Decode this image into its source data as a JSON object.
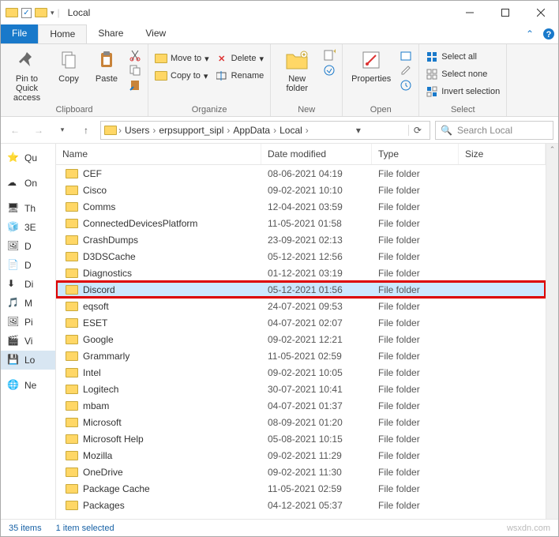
{
  "window": {
    "title": "Local"
  },
  "tabs": {
    "file": "File",
    "home": "Home",
    "share": "Share",
    "view": "View"
  },
  "ribbon": {
    "clipboard": {
      "pin": "Pin to Quick\naccess",
      "copy": "Copy",
      "paste": "Paste",
      "label": "Clipboard"
    },
    "organize": {
      "moveto": "Move to",
      "copyto": "Copy to",
      "delete": "Delete",
      "rename": "Rename",
      "label": "Organize"
    },
    "new": {
      "newfolder": "New\nfolder",
      "label": "New"
    },
    "open": {
      "properties": "Properties",
      "label": "Open"
    },
    "select": {
      "all": "Select all",
      "none": "Select none",
      "invert": "Invert selection",
      "label": "Select"
    }
  },
  "breadcrumb": [
    "Users",
    "erpsupport_sipl",
    "AppData",
    "Local"
  ],
  "search": {
    "placeholder": "Search Local"
  },
  "columns": {
    "name": "Name",
    "date": "Date modified",
    "type": "Type",
    "size": "Size"
  },
  "sidebar": [
    {
      "ic": "star",
      "label": "Qu"
    },
    {
      "ic": "cloud",
      "label": "On"
    },
    {
      "ic": "pc",
      "label": "Th"
    },
    {
      "ic": "cube",
      "label": "3E"
    },
    {
      "ic": "desk",
      "label": "D"
    },
    {
      "ic": "doc",
      "label": "D"
    },
    {
      "ic": "down",
      "label": "Di"
    },
    {
      "ic": "music",
      "label": "M"
    },
    {
      "ic": "pic",
      "label": "Pi"
    },
    {
      "ic": "vid",
      "label": "Vi"
    },
    {
      "ic": "disk",
      "label": "Lo",
      "sel": true
    },
    {
      "ic": "net",
      "label": "Ne"
    }
  ],
  "files": [
    {
      "name": "CEF",
      "date": "08-06-2021 04:19",
      "type": "File folder"
    },
    {
      "name": "Cisco",
      "date": "09-02-2021 10:10",
      "type": "File folder"
    },
    {
      "name": "Comms",
      "date": "12-04-2021 03:59",
      "type": "File folder"
    },
    {
      "name": "ConnectedDevicesPlatform",
      "date": "11-05-2021 01:58",
      "type": "File folder"
    },
    {
      "name": "CrashDumps",
      "date": "23-09-2021 02:13",
      "type": "File folder"
    },
    {
      "name": "D3DSCache",
      "date": "05-12-2021 12:56",
      "type": "File folder"
    },
    {
      "name": "Diagnostics",
      "date": "01-12-2021 03:19",
      "type": "File folder"
    },
    {
      "name": "Discord",
      "date": "05-12-2021 01:56",
      "type": "File folder",
      "sel": true,
      "hl": true
    },
    {
      "name": "eqsoft",
      "date": "24-07-2021 09:53",
      "type": "File folder"
    },
    {
      "name": "ESET",
      "date": "04-07-2021 02:07",
      "type": "File folder"
    },
    {
      "name": "Google",
      "date": "09-02-2021 12:21",
      "type": "File folder"
    },
    {
      "name": "Grammarly",
      "date": "11-05-2021 02:59",
      "type": "File folder"
    },
    {
      "name": "Intel",
      "date": "09-02-2021 10:05",
      "type": "File folder"
    },
    {
      "name": "Logitech",
      "date": "30-07-2021 10:41",
      "type": "File folder"
    },
    {
      "name": "mbam",
      "date": "04-07-2021 01:37",
      "type": "File folder"
    },
    {
      "name": "Microsoft",
      "date": "08-09-2021 01:20",
      "type": "File folder"
    },
    {
      "name": "Microsoft Help",
      "date": "05-08-2021 10:15",
      "type": "File folder"
    },
    {
      "name": "Mozilla",
      "date": "09-02-2021 11:29",
      "type": "File folder"
    },
    {
      "name": "OneDrive",
      "date": "09-02-2021 11:30",
      "type": "File folder"
    },
    {
      "name": "Package Cache",
      "date": "11-05-2021 02:59",
      "type": "File folder"
    },
    {
      "name": "Packages",
      "date": "04-12-2021 05:37",
      "type": "File folder"
    }
  ],
  "status": {
    "items": "35 items",
    "selected": "1 item selected"
  },
  "watermark": "wsxdn.com"
}
